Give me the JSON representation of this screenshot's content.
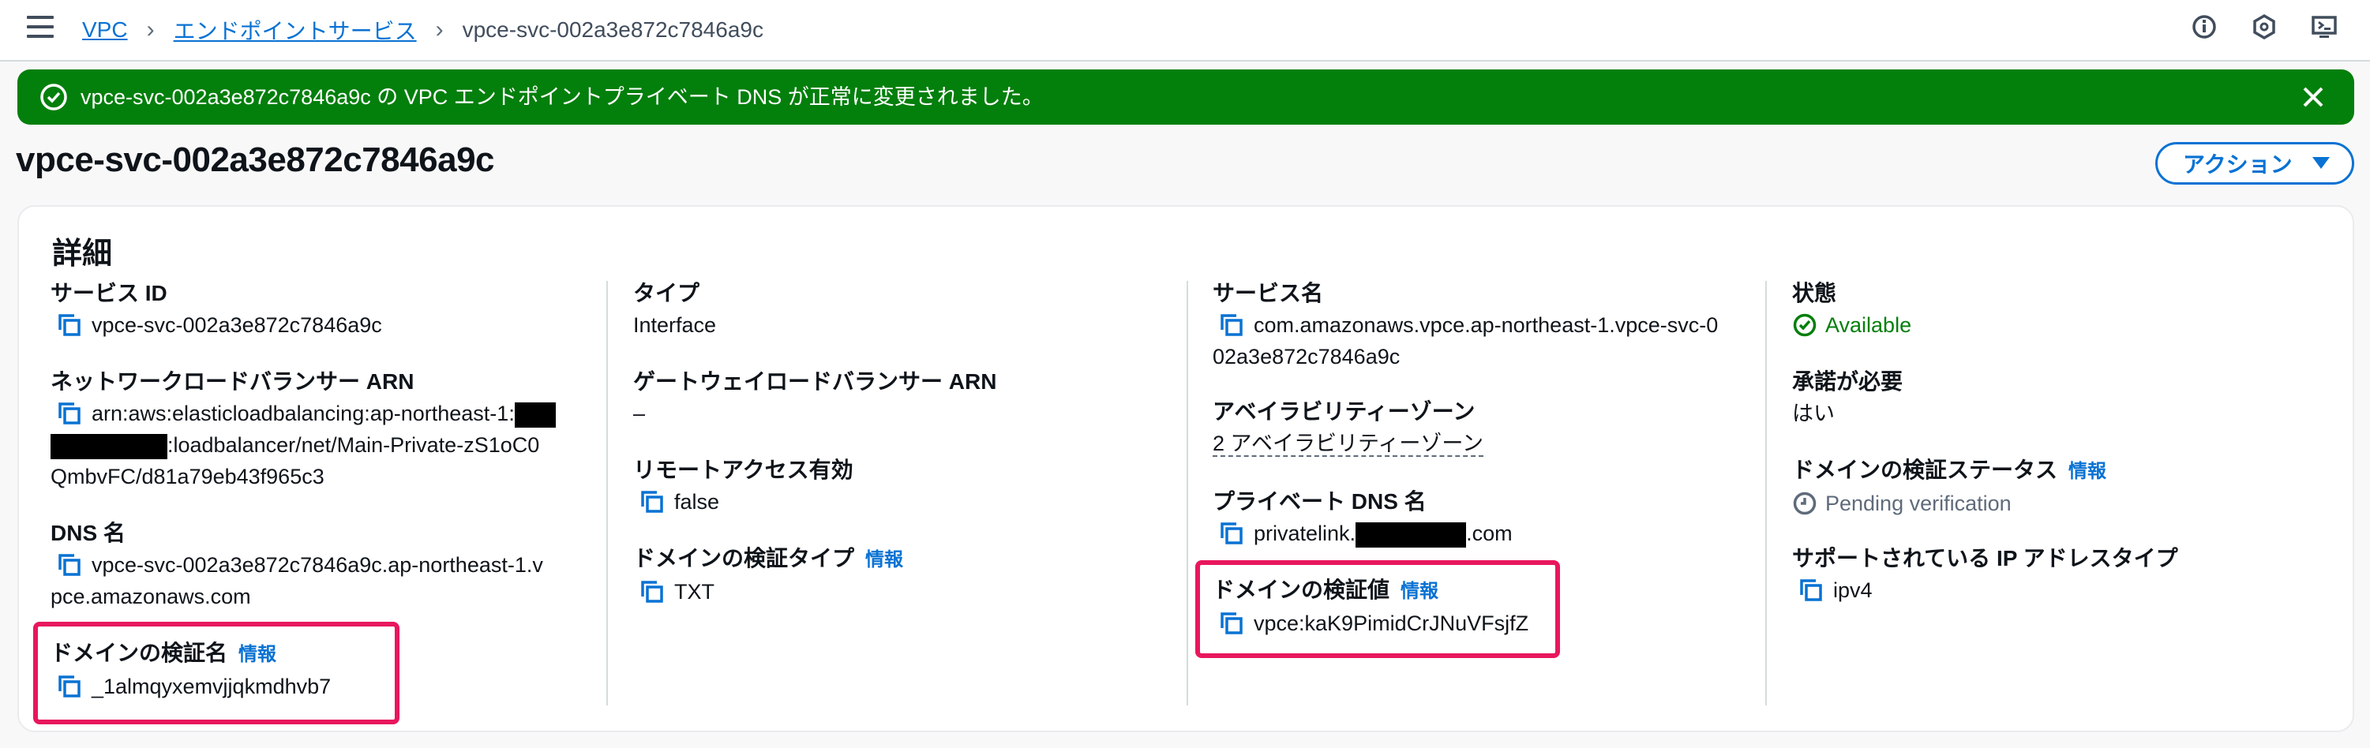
{
  "breadcrumb": {
    "root": "VPC",
    "parent": "エンドポイントサービス",
    "current": "vpce-svc-002a3e872c7846a9c"
  },
  "flash": {
    "message": "vpce-svc-002a3e872c7846a9c の VPC エンドポイントプライベート DNS が正常に変更されました。"
  },
  "header": {
    "title": "vpce-svc-002a3e872c7846a9c",
    "action_label": "アクション"
  },
  "details": {
    "title": "詳細",
    "info_label": "情報",
    "col1": {
      "service_id_label": "サービス ID",
      "service_id": "vpce-svc-002a3e872c7846a9c",
      "nlb_arn_label": "ネットワークロードバランサー ARN",
      "nlb_arn_line1": "arn:aws:elasticloadbalancing:ap-northeast-1:",
      "nlb_arn_line2": ":loadbalancer/net/Main-Private-zS1oC0",
      "nlb_arn_line3": "QmbvFC/d81a79eb43f965c3",
      "dns_name_label": "DNS 名",
      "dns_name_line1": "vpce-svc-002a3e872c7846a9c.ap-northeast-1.v",
      "dns_name_line2": "pce.amazonaws.com",
      "domain_verif_name_label": "ドメインの検証名",
      "domain_verif_name": "_1almqyxemvjjqkmdhvb7"
    },
    "col2": {
      "type_label": "タイプ",
      "type": "Interface",
      "gwlb_arn_label": "ゲートウェイロードバランサー ARN",
      "gwlb_arn": "–",
      "remote_access_label": "リモートアクセス有効",
      "remote_access": "false",
      "domain_verif_type_label": "ドメインの検証タイプ",
      "domain_verif_type": "TXT"
    },
    "col3": {
      "service_name_label": "サービス名",
      "service_name_line1": "com.amazonaws.vpce.ap-northeast-1.vpce-svc-0",
      "service_name_line2": "02a3e872c7846a9c",
      "az_label": "アベイラビリティーゾーン",
      "az": "2 アベイラビリティーゾーン",
      "private_dns_label": "プライベート DNS 名",
      "private_dns_prefix": "privatelink.",
      "private_dns_suffix": ".com",
      "domain_verif_value_label": "ドメインの検証値",
      "domain_verif_value": "vpce:kaK9PimidCrJNuVFsjfZ"
    },
    "col4": {
      "state_label": "状態",
      "state": "Available",
      "acceptance_label": "承諾が必要",
      "acceptance": "はい",
      "domain_verif_status_label": "ドメインの検証ステータス",
      "domain_verif_status": "Pending verification",
      "ip_type_label": "サポートされている IP アドレスタイプ",
      "ip_type": "ipv4"
    }
  },
  "colors": {
    "accent": "#0972d3",
    "success": "#037f0c",
    "highlight": "#e8175d"
  }
}
